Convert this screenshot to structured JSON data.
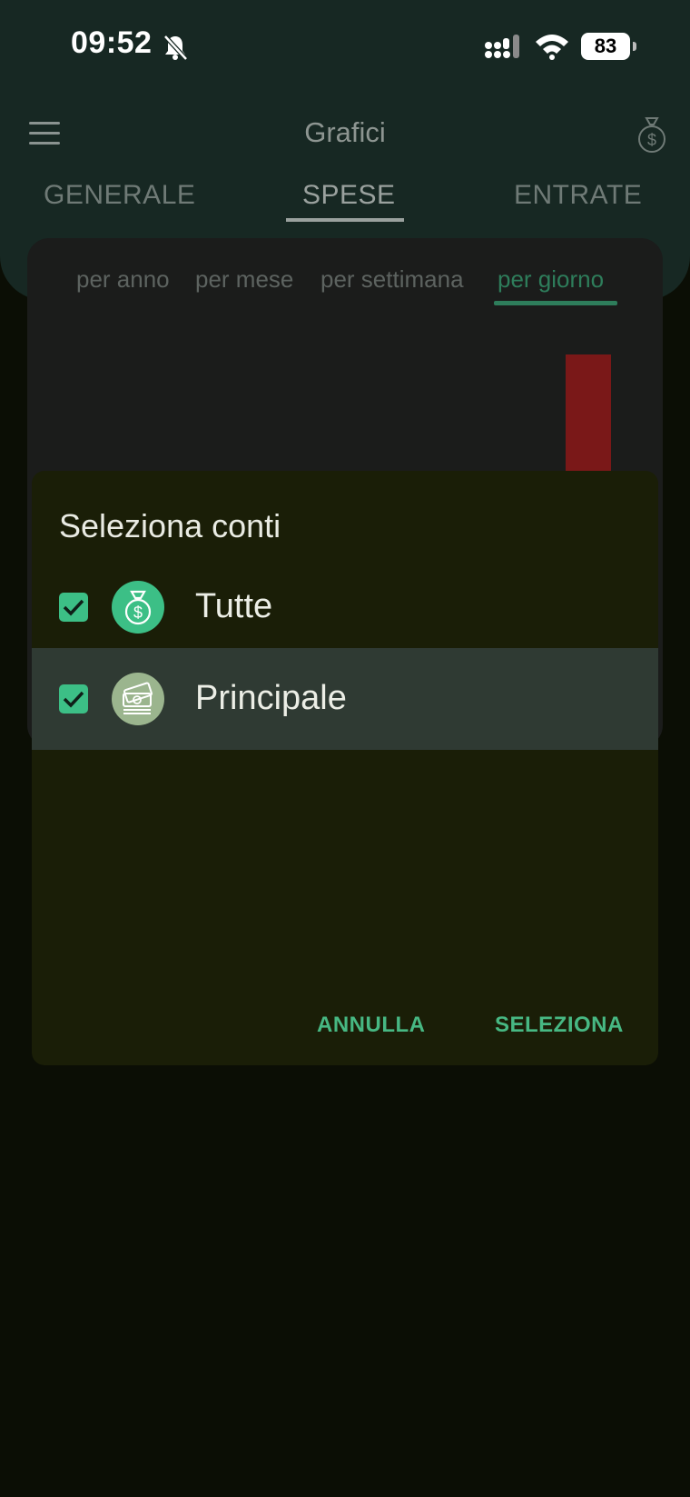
{
  "status_bar": {
    "time": "09:52",
    "battery": "83"
  },
  "header": {
    "title": "Grafici",
    "tabs": [
      {
        "label": "GENERALE"
      },
      {
        "label": "SPESE"
      },
      {
        "label": "ENTRATE"
      }
    ],
    "active_tab": "SPESE"
  },
  "period_tabs": [
    {
      "label": "per anno"
    },
    {
      "label": "per mese"
    },
    {
      "label": "per settimana"
    },
    {
      "label": "per giorno"
    }
  ],
  "active_period": "per giorno",
  "dialog": {
    "title": "Seleziona conti",
    "accounts": [
      {
        "label": "Tutte",
        "checked": true,
        "icon": "money-bag-icon"
      },
      {
        "label": "Principale",
        "checked": true,
        "icon": "cash-stack-icon"
      }
    ],
    "cancel_label": "ANNULLA",
    "confirm_label": "SELEZIONA"
  },
  "colors": {
    "accent": "#3cbf86",
    "bar_expense": "#7a1818",
    "header_bg": "#172823",
    "dialog_bg": "#1a1e07"
  }
}
